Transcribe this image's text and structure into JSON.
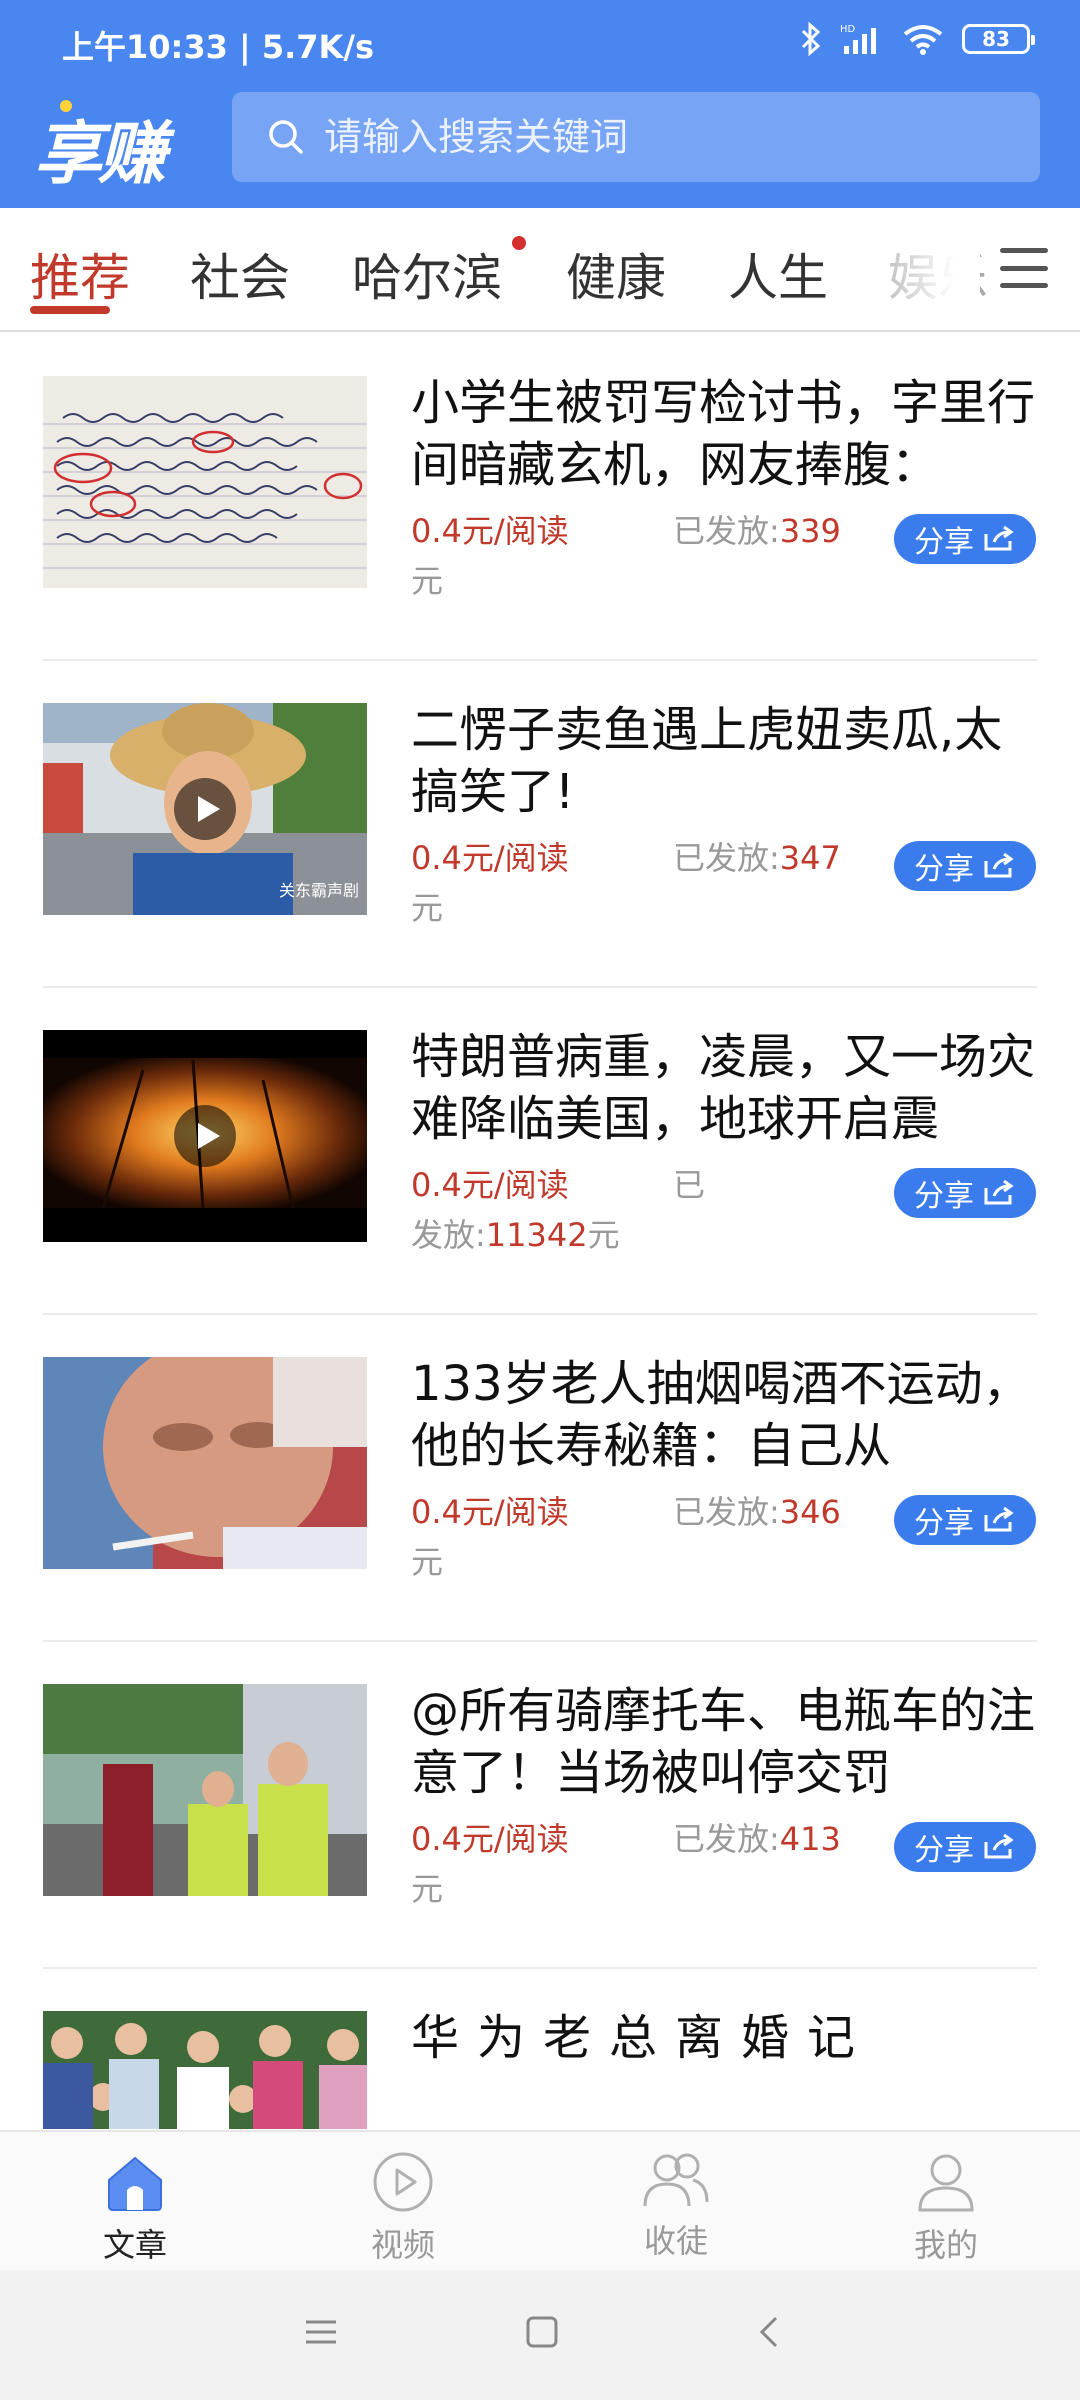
{
  "status_bar": {
    "time_speed": "上午10:33 | 5.7K/s",
    "battery": "83"
  },
  "header": {
    "logo": "享赚",
    "search_placeholder": "请输入搜索关键词"
  },
  "tabs": [
    {
      "label": "推荐",
      "active": true
    },
    {
      "label": "社会"
    },
    {
      "label": "哈尔滨",
      "has_dot": true
    },
    {
      "label": "健康"
    },
    {
      "label": "人生"
    },
    {
      "label": "娱乐"
    }
  ],
  "articles": [
    {
      "title": "小学生被罚写检讨书，字里行间暗藏玄机，网友捧腹：",
      "reward": "0.4元/阅读",
      "paid_label": "已发放:",
      "paid_amount": "339",
      "unit": "元",
      "share": "分享",
      "thumb": "handwritten-letter",
      "video": false
    },
    {
      "title": "二愣子卖鱼遇上虎妞卖瓜,太搞笑了!",
      "reward": "0.4元/阅读",
      "paid_label": "已发放:",
      "paid_amount": "347",
      "unit": "元",
      "share": "分享",
      "thumb": "man-straw-hat",
      "video": true
    },
    {
      "title": "特朗普病重，凌晨，又一场灾难降临美国，地球开启震",
      "reward": "0.4元/阅读",
      "paid_label": "已发放:",
      "paid_amount": "11342",
      "unit": "元",
      "share": "分享",
      "thumb": "fire-night",
      "video": true
    },
    {
      "title": "133岁老人抽烟喝酒不运动，他的长寿秘籍：自己从",
      "reward": "0.4元/阅读",
      "paid_label": "已发放:",
      "paid_amount": "346",
      "unit": "元",
      "share": "分享",
      "thumb": "elderly-woman",
      "video": false
    },
    {
      "title": "@所有骑摩托车、电瓶车的注意了！当场被叫停交罚",
      "reward": "0.4元/阅读",
      "paid_label": "已发放:",
      "paid_amount": "413",
      "unit": "元",
      "share": "分享",
      "thumb": "traffic-police",
      "video": false
    },
    {
      "title": "华为老总离婚记",
      "thumb": "group-photo",
      "video": false
    }
  ],
  "video_watermark": "关东霸声剧",
  "bottom_nav": [
    {
      "label": "文章",
      "icon": "home-icon",
      "active": true
    },
    {
      "label": "视频",
      "icon": "play-circle-icon"
    },
    {
      "label": "收徒",
      "icon": "users-icon"
    },
    {
      "label": "我的",
      "icon": "user-icon"
    }
  ],
  "colors": {
    "header_blue": "#4a86f0",
    "accent_red": "#c0392b",
    "share_blue": "#3b7ced"
  }
}
